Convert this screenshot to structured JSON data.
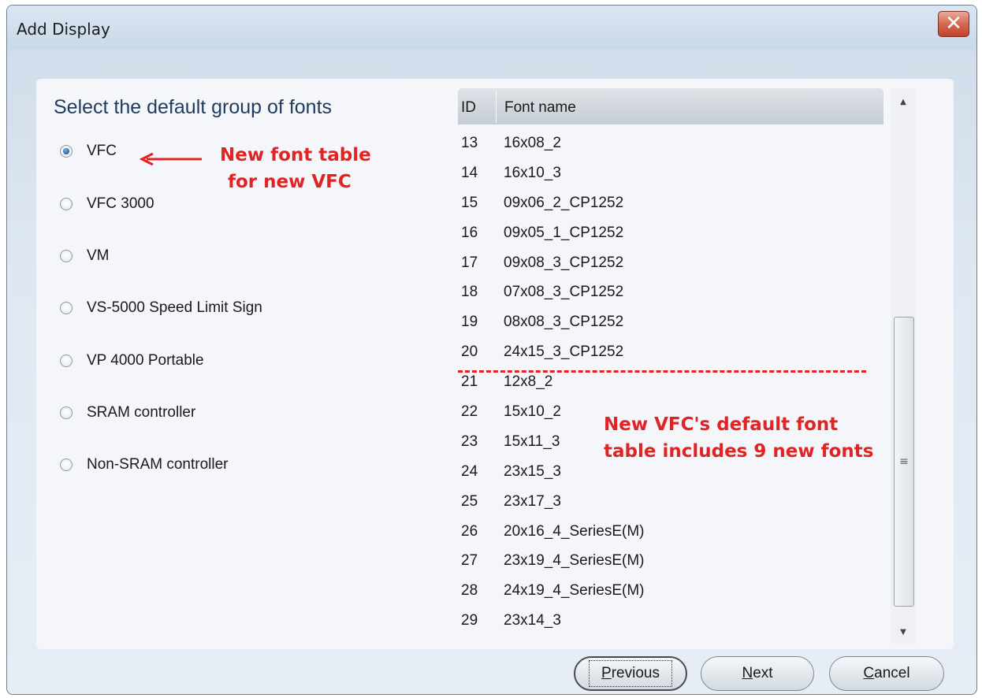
{
  "window": {
    "title": "Add Display",
    "close_glyph": "✕"
  },
  "left_panel": {
    "heading": "Select the default group of fonts",
    "options": [
      {
        "label": "VFC",
        "checked": true
      },
      {
        "label": "VFC 3000",
        "checked": false
      },
      {
        "label": "VM",
        "checked": false
      },
      {
        "label": "VS-5000 Speed Limit Sign",
        "checked": false
      },
      {
        "label": "VP 4000 Portable",
        "checked": false
      },
      {
        "label": "SRAM controller",
        "checked": false
      },
      {
        "label": "Non-SRAM controller",
        "checked": false
      }
    ]
  },
  "annotations": {
    "arrow_line1": "New font table",
    "arrow_line2": "for new VFC",
    "table_line1": "New VFC's default font",
    "table_line2": "table includes 9 new fonts",
    "color": "#e02424"
  },
  "font_list": {
    "columns": [
      "ID",
      "Font name"
    ],
    "rows": [
      [
        "13",
        "16x08_2"
      ],
      [
        "14",
        "16x10_3"
      ],
      [
        "15",
        "09x06_2_CP1252"
      ],
      [
        "16",
        "09x05_1_CP1252"
      ],
      [
        "17",
        "09x08_3_CP1252"
      ],
      [
        "18",
        "07x08_3_CP1252"
      ],
      [
        "19",
        "08x08_3_CP1252"
      ],
      [
        "20",
        "24x15_3_CP1252"
      ],
      [
        "21",
        "12x8_2"
      ],
      [
        "22",
        "15x10_2"
      ],
      [
        "23",
        "15x11_3"
      ],
      [
        "24",
        "23x15_3"
      ],
      [
        "25",
        "23x17_3"
      ],
      [
        "26",
        "20x16_4_SeriesE(M)"
      ],
      [
        "27",
        "23x19_4_SeriesE(M)"
      ],
      [
        "28",
        "24x19_4_SeriesE(M)"
      ],
      [
        "29",
        "23x14_3"
      ]
    ]
  },
  "scrollbar": {
    "up_glyph": "▲",
    "down_glyph": "▼",
    "grip_glyph": "≡"
  },
  "buttons": {
    "previous_first": "P",
    "previous_rest": "revious",
    "next_first": "N",
    "next_rest": "ext",
    "cancel_first": "C",
    "cancel_rest": "ancel"
  },
  "colors": {
    "heading": "#1f3b5d",
    "radio_checked": "#2e6bb0",
    "close_button": "#c0432b"
  }
}
